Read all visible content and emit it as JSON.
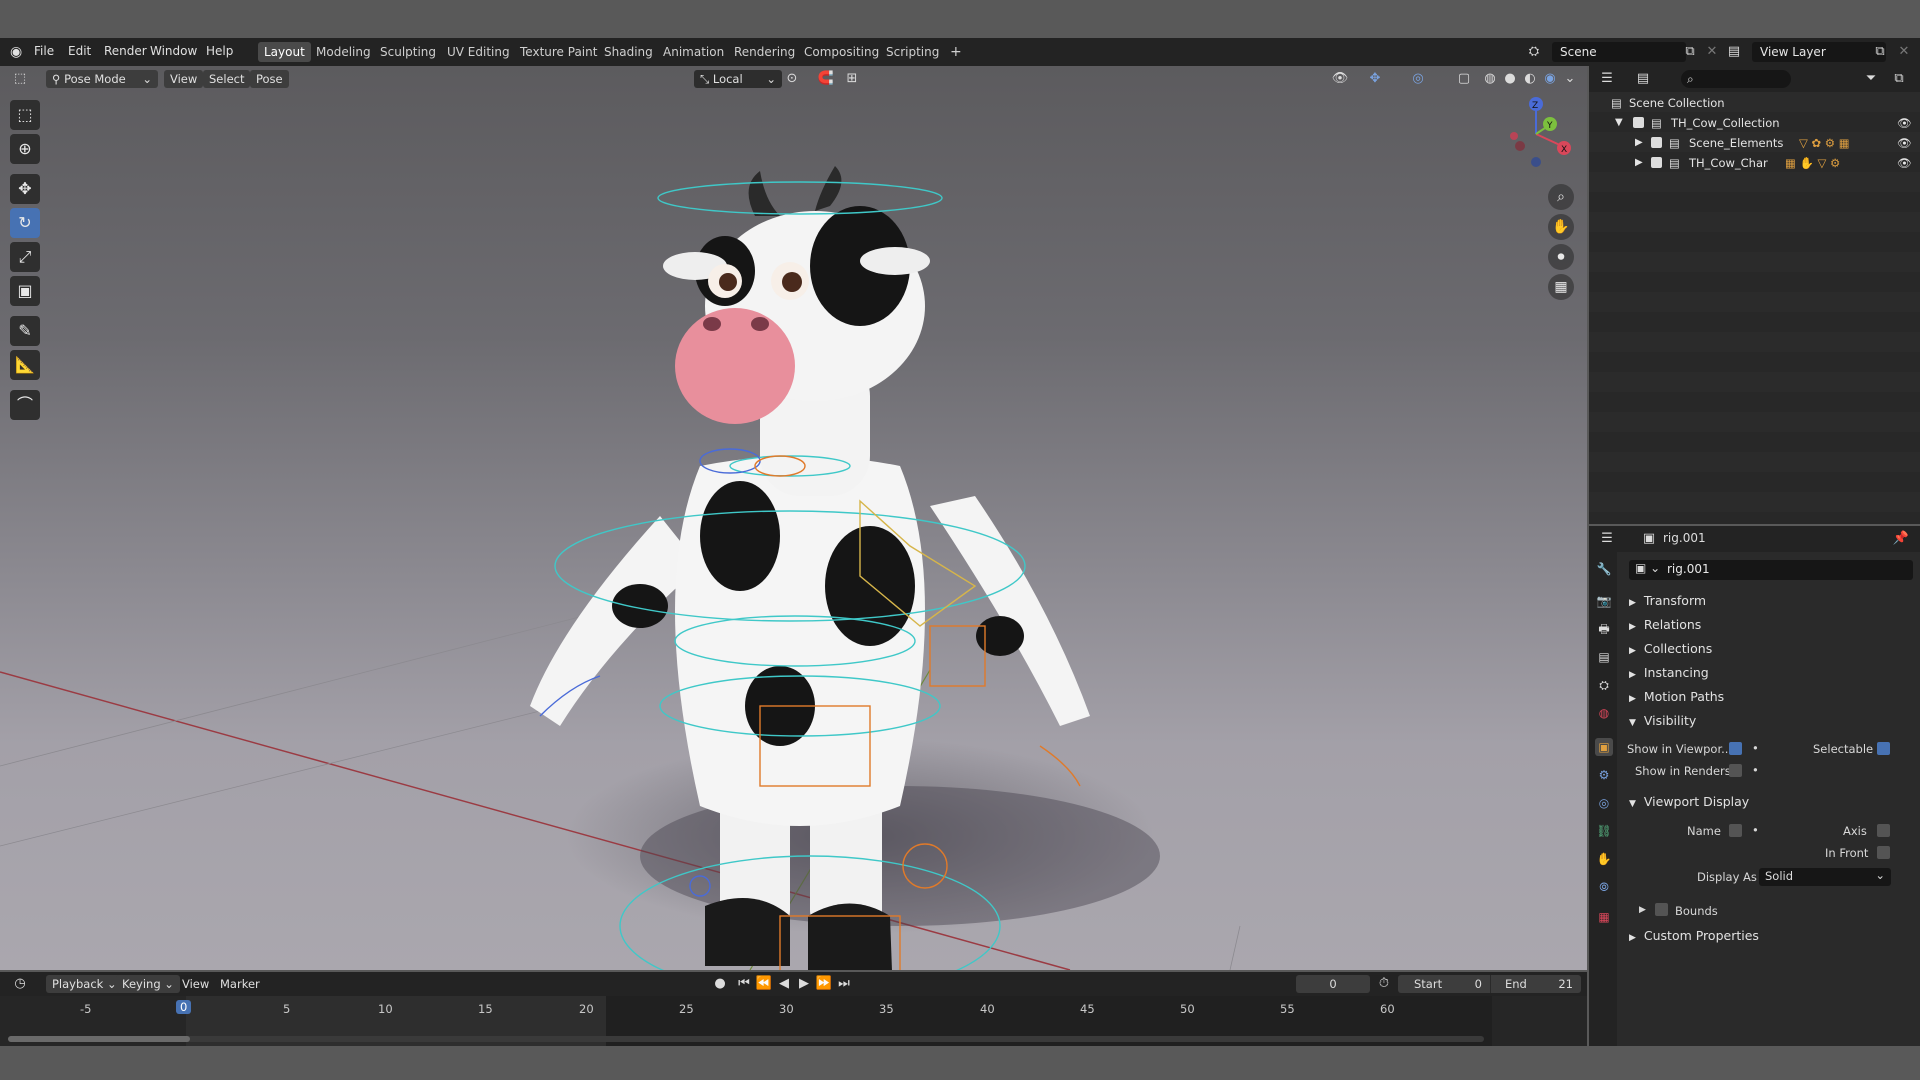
{
  "menu": [
    "File",
    "Edit",
    "Render",
    "Window",
    "Help"
  ],
  "workspaces": [
    "Layout",
    "Modeling",
    "Sculpting",
    "UV Editing",
    "Texture Paint",
    "Shading",
    "Animation",
    "Rendering",
    "Compositing",
    "Scripting"
  ],
  "active_workspace": "Layout",
  "scene": {
    "label": "Scene"
  },
  "view_layer": {
    "label": "View Layer"
  },
  "viewport": {
    "mode": "Pose Mode",
    "menus": [
      "View",
      "Select",
      "Pose"
    ],
    "orientation": "Local",
    "gizmo_axes": {
      "x": "X",
      "y": "Y",
      "z": "Z"
    }
  },
  "outliner": {
    "root": "Scene Collection",
    "items": [
      {
        "label": "TH_Cow_Collection"
      },
      {
        "label": "Scene_Elements"
      },
      {
        "label": "TH_Cow_Char"
      }
    ]
  },
  "properties": {
    "object_name": "rig.001",
    "name_field": "rig.001",
    "sections": [
      "Transform",
      "Relations",
      "Collections",
      "Instancing",
      "Motion Paths",
      "Visibility"
    ],
    "visibility": {
      "show_in_viewport": "Show in Viewpor..",
      "selectable": "Selectable",
      "show_in_renders": "Show in Renders"
    },
    "viewport_display": {
      "title": "Viewport Display",
      "name": "Name",
      "axis": "Axis",
      "in_front": "In Front",
      "display_as_label": "Display As",
      "display_as_value": "Solid",
      "bounds": "Bounds"
    },
    "custom_properties": "Custom Properties"
  },
  "timeline": {
    "menus": [
      "Playback",
      "Keying",
      "View",
      "Marker"
    ],
    "current_frame": "0",
    "start_label": "Start",
    "start": "0",
    "end_label": "End",
    "end": "21",
    "ticks": [
      "-5",
      "0",
      "5",
      "10",
      "15",
      "20",
      "25",
      "30",
      "35",
      "40",
      "45",
      "50",
      "55",
      "60"
    ]
  },
  "colors": {
    "accent": "#4772b3",
    "header": "#232323",
    "panel": "#2a2a2a",
    "bone_cyan": "#3fc8c8",
    "bone_orange": "#e07a2a"
  }
}
